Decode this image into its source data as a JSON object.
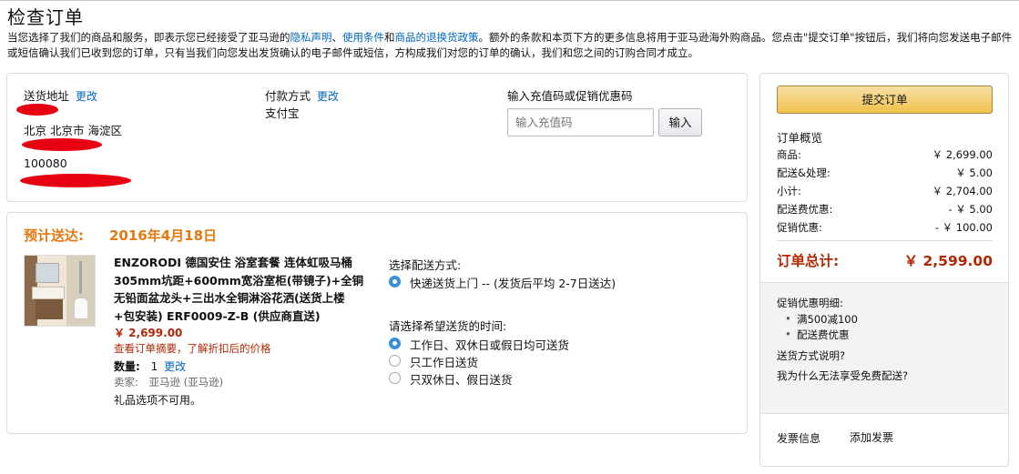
{
  "page": {
    "title": "检查订单",
    "notice_parts": [
      "当您选择了我们的商品和服务，即表示您已经接受了亚马逊的",
      "隐私声明",
      "、",
      "使用条件",
      "和",
      "商品的退换货政策",
      "。额外的条款和本页下方的更多信息将用于亚马逊海外购商品。您点击\"提交订单\"按钮后，我们将向您发送电子邮件或短信确认我们已收到您的订单，只有当我们向您发出发货确认的电子邮件或短信，方构成我们对您的订单的确认，我们和您之间的订购合同才成立。"
    ]
  },
  "address": {
    "heading": "送货地址",
    "change": "更改",
    "line_city": "北京 北京市 海淀区",
    "zip": "100080"
  },
  "payment": {
    "heading": "付款方式",
    "change": "更改",
    "method": "支付宝"
  },
  "coupon": {
    "heading": "输入充值码或促销优惠码",
    "placeholder": "输入充值码",
    "apply": "输入"
  },
  "shipment": {
    "eta_label": "预计送达:",
    "eta_date": "2016年4月18日",
    "product": {
      "brand": "ENZORODI",
      "title": " 德国安住 浴室套餐 连体虹吸马桶305mm坑距+600mm宽浴室柜(带镜子)+全铜无铅面盆龙头+三出水全铜淋浴花洒(送货上楼+包安装) ERF0009-Z-B (供应商直送)",
      "price": "￥ 2,699.00",
      "promo_note": "查看订单摘要，了解折扣后的价格",
      "qty_label": "数量:",
      "qty_value": "1",
      "qty_change": "更改",
      "seller_label": "卖家:",
      "seller_value": "亚马逊 (亚马逊)",
      "gift": "礼品选项不可用。"
    },
    "method_heading": "选择配送方式:",
    "method_option": "快递送货上门 --   (发货后平均 2-7日送达)",
    "time_heading": "请选择希望送货的时间:",
    "time_options": [
      "工作日、双休日或假日均可送货",
      "只工作日送货",
      "只双休日、假日送货"
    ],
    "time_selected": 0
  },
  "summary": {
    "submit": "提交订单",
    "heading": "订单概览",
    "rows": [
      {
        "label": "商品:",
        "value": "￥ 2,699.00"
      },
      {
        "label": "配送&处理:",
        "value": "￥ 5.00"
      },
      {
        "label": "小计:",
        "value": "￥ 2,704.00"
      },
      {
        "label": "配送费优惠:",
        "value": "- ￥ 5.00"
      },
      {
        "label": "促销优惠:",
        "value": "- ￥ 100.00"
      }
    ],
    "total_label": "订单总计:",
    "total_value": "￥ 2,599.00",
    "promo_heading": "促销优惠明细:",
    "promo_items": [
      "满500减100",
      "配送费优惠"
    ],
    "link_ship": "送货方式说明?",
    "link_free": "我为什么无法享受免费配送?",
    "invoice_label": "发票信息",
    "invoice_link": "添加发票"
  },
  "colors": {
    "accent_orange": "#e47911",
    "price_red": "#b12704",
    "link_blue": "#0066c0",
    "submit_yellow": "#f0c14b",
    "radio_blue": "#3a8fd9"
  }
}
